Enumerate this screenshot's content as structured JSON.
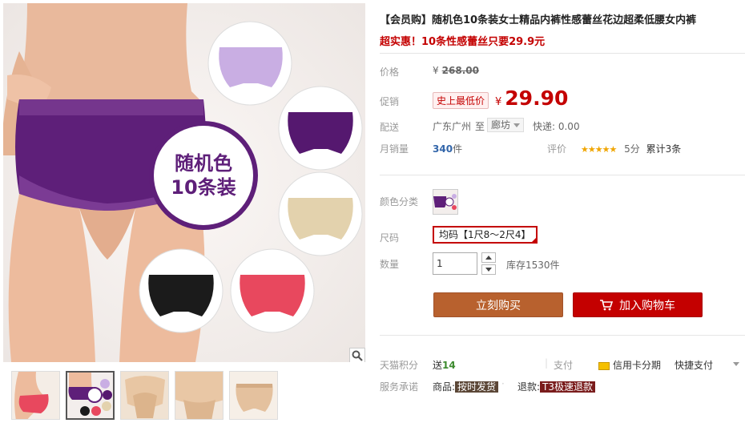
{
  "product": {
    "title": "【会员购】随机色10条装女士精品内裤性感蕾丝花边超柔低腰女内裤",
    "subtitle": "超实惠！10条性感蕾丝只要29.9元"
  },
  "gallery": {
    "badge_line1": "随机色",
    "badge_line2": "10条装",
    "zoom_icon": "magnifier-icon",
    "thumbnails": [
      {
        "label": "thumbnail-1",
        "active": false
      },
      {
        "label": "thumbnail-2",
        "active": true
      },
      {
        "label": "thumbnail-3",
        "active": false
      },
      {
        "label": "thumbnail-4",
        "active": false
      },
      {
        "label": "thumbnail-5",
        "active": false
      }
    ]
  },
  "price": {
    "label": "价格",
    "currency": "¥",
    "original": "268.00"
  },
  "promo": {
    "label": "促销",
    "tag": "史上最低价",
    "currency": "¥",
    "price": "29.90"
  },
  "shipping": {
    "label": "配送",
    "origin": "广东广州",
    "to": "至",
    "destination": "廊坊",
    "fee": "快递: 0.00"
  },
  "sales": {
    "label": "月销量",
    "count": "340",
    "unit": "件",
    "review_label": "评价",
    "stars": "★★★★★",
    "score": "5分",
    "review_count": "累计3条"
  },
  "options": {
    "color_label": "颜色分类",
    "size_label": "尺码",
    "size_value": "均码【1尺8～2尺4】",
    "qty_label": "数量",
    "qty_value": "1",
    "stock": "库存1530件"
  },
  "actions": {
    "buy_now": "立刻购买",
    "add_to_cart": "加入购物车"
  },
  "extras": {
    "points_label": "天猫积分",
    "points_prefix": "送",
    "points_value": "14",
    "pay_label": "支付",
    "credit_installment": "信用卡分期",
    "quick_pay": "快捷支付",
    "service_label": "服务承诺",
    "goods_prefix": "商品:",
    "goods_tag": "按时发货",
    "refund_prefix": "退款:",
    "refund_tag": "T3极速退款"
  },
  "colors": {
    "price_red": "#c40000",
    "buy_button": "#b8612e",
    "cart_button": "#c40000",
    "sales_blue": "#3366aa",
    "star_gold": "#f0a500"
  }
}
